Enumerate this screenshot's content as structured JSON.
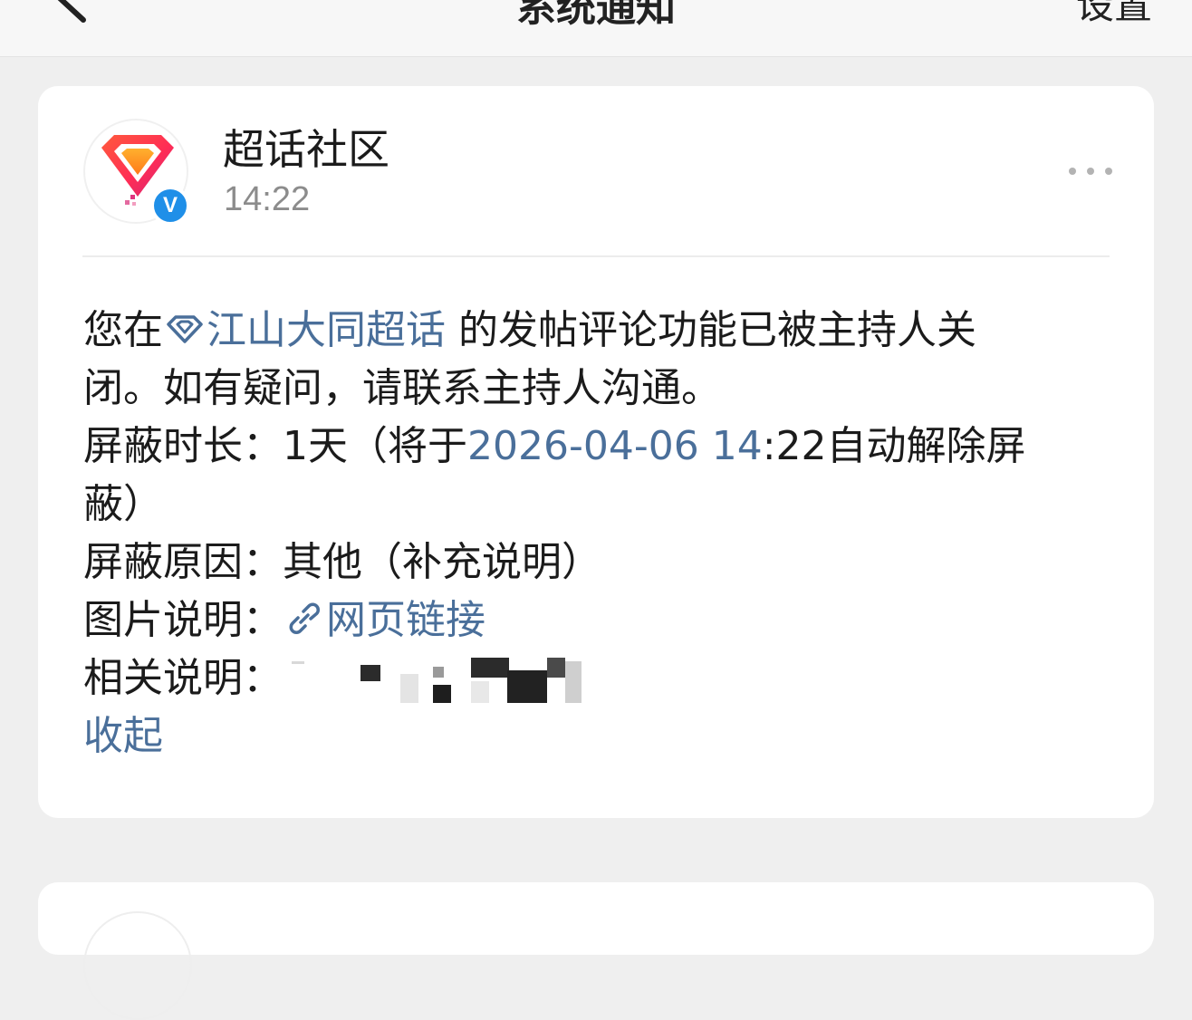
{
  "header": {
    "title": "系统通知",
    "settings_label": "设置",
    "back_icon": "chevron-left-icon"
  },
  "notification": {
    "sender": {
      "name": "超话社区",
      "time": "14:22",
      "avatar_icon": "super-topic-diamond-logo",
      "verified_badge": "V"
    },
    "more_icon": "more-dots-icon",
    "message": {
      "prefix": "您在",
      "topic_icon": "diamond-icon",
      "topic_name": "江山大同超话",
      "line1_rest": "的发帖评论功能已被主持人关",
      "line2": "闭。如有疑问，请联系主持人沟通。",
      "duration_label": "屏蔽时长：",
      "duration_value": "1天（将于",
      "unblock_date": "2026-04-06 14",
      "unblock_rest": ":22自动解除屏",
      "duration_wrap": "蔽）",
      "reason_label": "屏蔽原因：",
      "reason_value": "其他（补充说明）",
      "image_label": "图片说明：",
      "link_icon": "link-icon",
      "link_label": "网页链接",
      "related_label": "相关说明："
    },
    "collapse_label": "收起"
  },
  "colors": {
    "link_blue": "#4a6f9a",
    "verified_blue": "#1f8fe8",
    "background": "#efefef",
    "card": "#ffffff"
  }
}
